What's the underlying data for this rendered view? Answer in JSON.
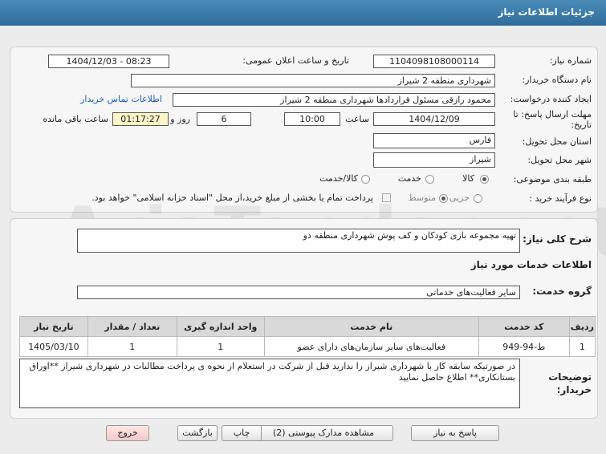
{
  "window": {
    "title": "جزئیات اطلاعات نیاز"
  },
  "fields": {
    "need_number_label": "شماره نیاز:",
    "need_number": "1104098108000114",
    "announce_label": "تاریخ و ساعت اعلان عمومی:",
    "announce_value": "1404/12/03 - 08:23",
    "buyer_org_label": "نام دستگاه خریدار:",
    "buyer_org": "شهرداری منطقه 2 شیراز",
    "creator_label": "ایجاد کننده درخواست:",
    "creator": "محمود رازقی مسئول قراردادها شهرداری منطقه 2 شیراز",
    "contact_link": "اطلاعات تماس خریدار",
    "deadline_label": "مهلت ارسال پاسخ: تا تاریخ:",
    "deadline_date": "1404/12/09",
    "time_label": "ساعت",
    "deadline_time": "10:00",
    "days": "6",
    "days_label": "روز و",
    "remaining": "01:17:27",
    "remaining_label": "ساعت باقی مانده",
    "province_label": "استان محل تحویل:",
    "province": "فارس",
    "city_label": "شهر محل تحویل:",
    "city": "شیراز",
    "category_label": "طبقه بندی موضوعی:",
    "category_options": [
      "کالا",
      "خدمت",
      "کالا/خدمت"
    ],
    "process_label": "نوع فرآیند خرید :",
    "process_options": [
      "جزیی",
      "متوسط"
    ],
    "payment_note": "پرداخت تمام یا بخشی از مبلغ خرید،از محل \"اسناد خزانه اسلامی\" خواهد بود."
  },
  "summary": {
    "label": "شرح کلی نیاز:",
    "value": "تهیه مجموعه بازی کودکان و کف پوش شهرداری منطقه دو"
  },
  "services": {
    "section_title": "اطلاعات خدمات مورد نیاز",
    "group_label": "گروه خدمت:",
    "group_value": "سایر فعالیت‌های خدماتی",
    "columns": [
      "ردیف",
      "کد خدمت",
      "نام خدمت",
      "واحد اندازه گیری",
      "تعداد / مقدار",
      "تاریخ نیاز"
    ],
    "rows": [
      {
        "idx": "1",
        "code": "ط-94-949",
        "name": "فعالیت‌های سایر سازمان‌های دارای عضو",
        "unit": "1",
        "qty": "1",
        "date": "1405/03/10"
      }
    ]
  },
  "buyer_notes": {
    "label": "توضیحات خریدار:",
    "text": "در صورتیکه سابقه کار با شهرداری شیراز را ندارید قبل از شرکت در استعلام از نحوه ی پرداخت مطالبات در شهرداری شیراز **اوراق بستانکاری** اطلاع حاصل نمایید"
  },
  "buttons": {
    "reply": "پاسخ به نیاز",
    "attachments": "مشاهده مدارک پیوستی (2)",
    "print": "چاپ",
    "back": "بازگشت",
    "exit": "خروج"
  },
  "watermark": "AriaTender.net"
}
